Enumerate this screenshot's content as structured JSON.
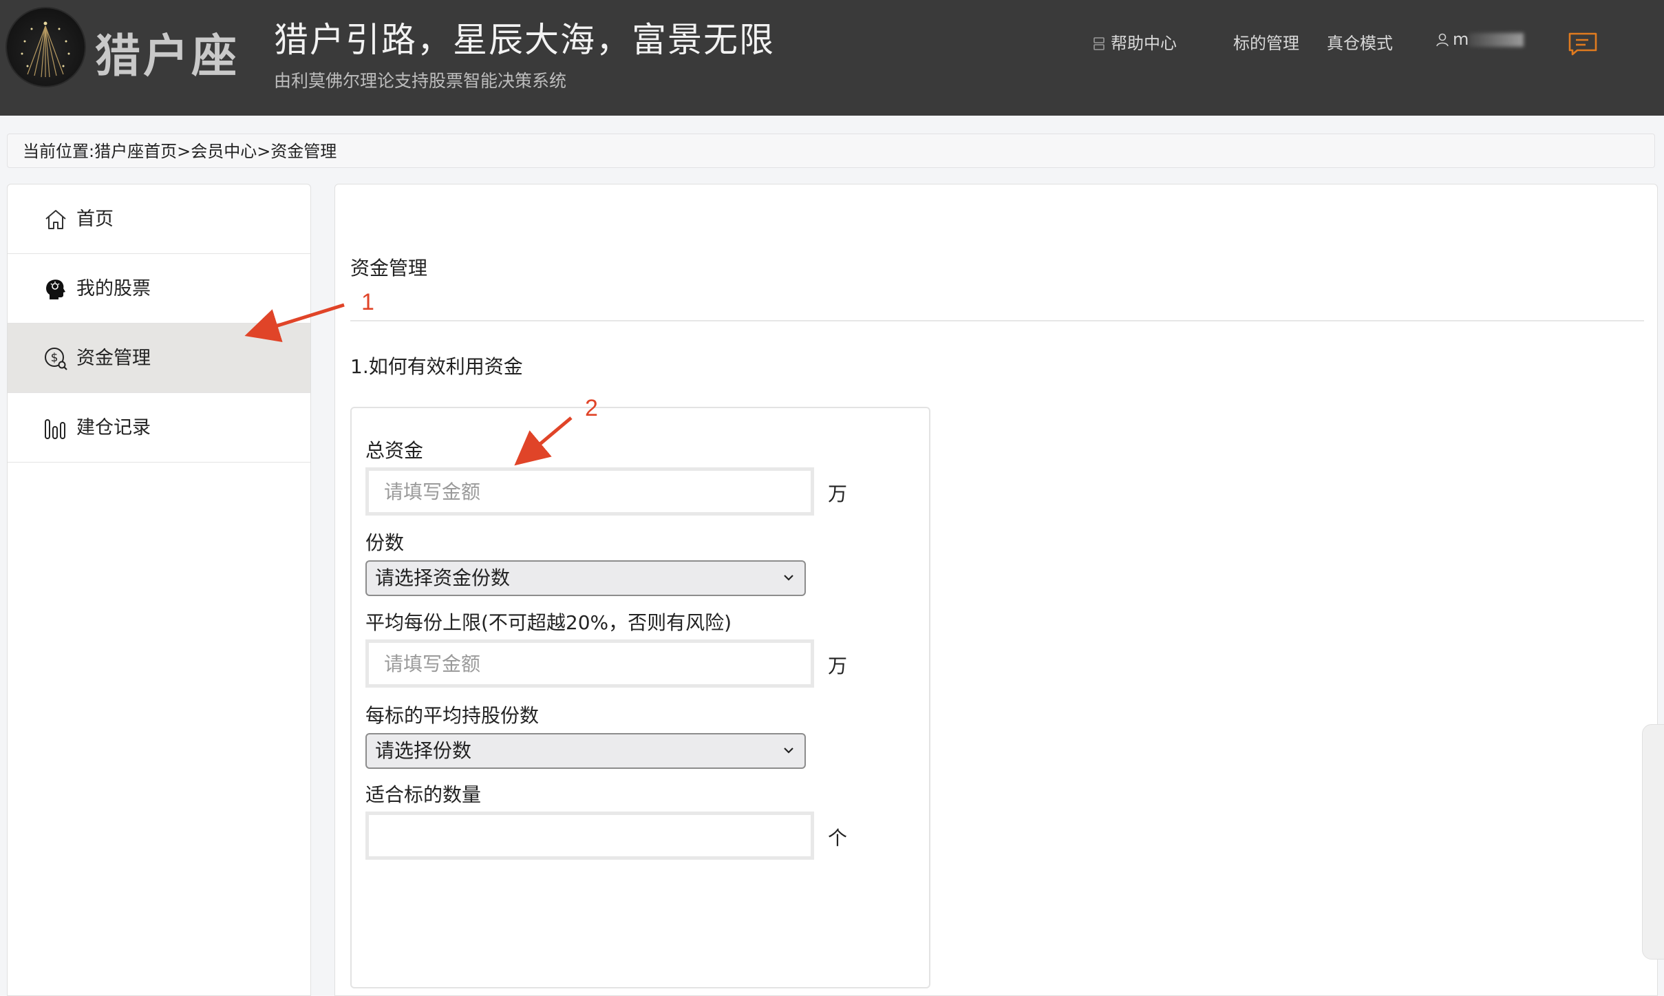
{
  "header": {
    "logo_text": "猎户座",
    "slogan": "猎户引路，星辰大海，富景无限",
    "subtitle": "由利莫佛尔理论支持股票智能决策系统",
    "nav": {
      "help": "帮助中心",
      "target_manage": "标的管理",
      "real_mode": "真仓模式",
      "user": "m"
    }
  },
  "breadcrumb": "当前位置:猎户座首页>会员中心>资金管理",
  "sidebar": {
    "items": [
      {
        "label": "首页",
        "icon": "home-icon"
      },
      {
        "label": "我的股票",
        "icon": "head-idea-icon"
      },
      {
        "label": "资金管理",
        "icon": "money-search-icon",
        "active": true
      },
      {
        "label": "建仓记录",
        "icon": "bar-chart-icon"
      }
    ]
  },
  "main": {
    "title": "资金管理",
    "subtitle": "1.如何有效利用资金",
    "form": {
      "total_label": "总资金",
      "total_placeholder": "请填写金额",
      "total_unit": "万",
      "shares_label": "份数",
      "shares_select": "请选择资金份数",
      "avg_label": "平均每份上限(不可超越20%，否则有风险)",
      "avg_placeholder": "请填写金额",
      "avg_unit": "万",
      "per_target_label": "每标的平均持股份数",
      "per_target_select": "请选择份数",
      "count_label": "适合标的数量",
      "count_value": "",
      "count_unit": "个"
    }
  },
  "annotations": {
    "one": "1",
    "two": "2",
    "color": "#e04428"
  },
  "colors": {
    "header_bg": "#3a3a3a",
    "active_item_bg": "#e6e5e3",
    "message_icon": "#e07b1f"
  }
}
